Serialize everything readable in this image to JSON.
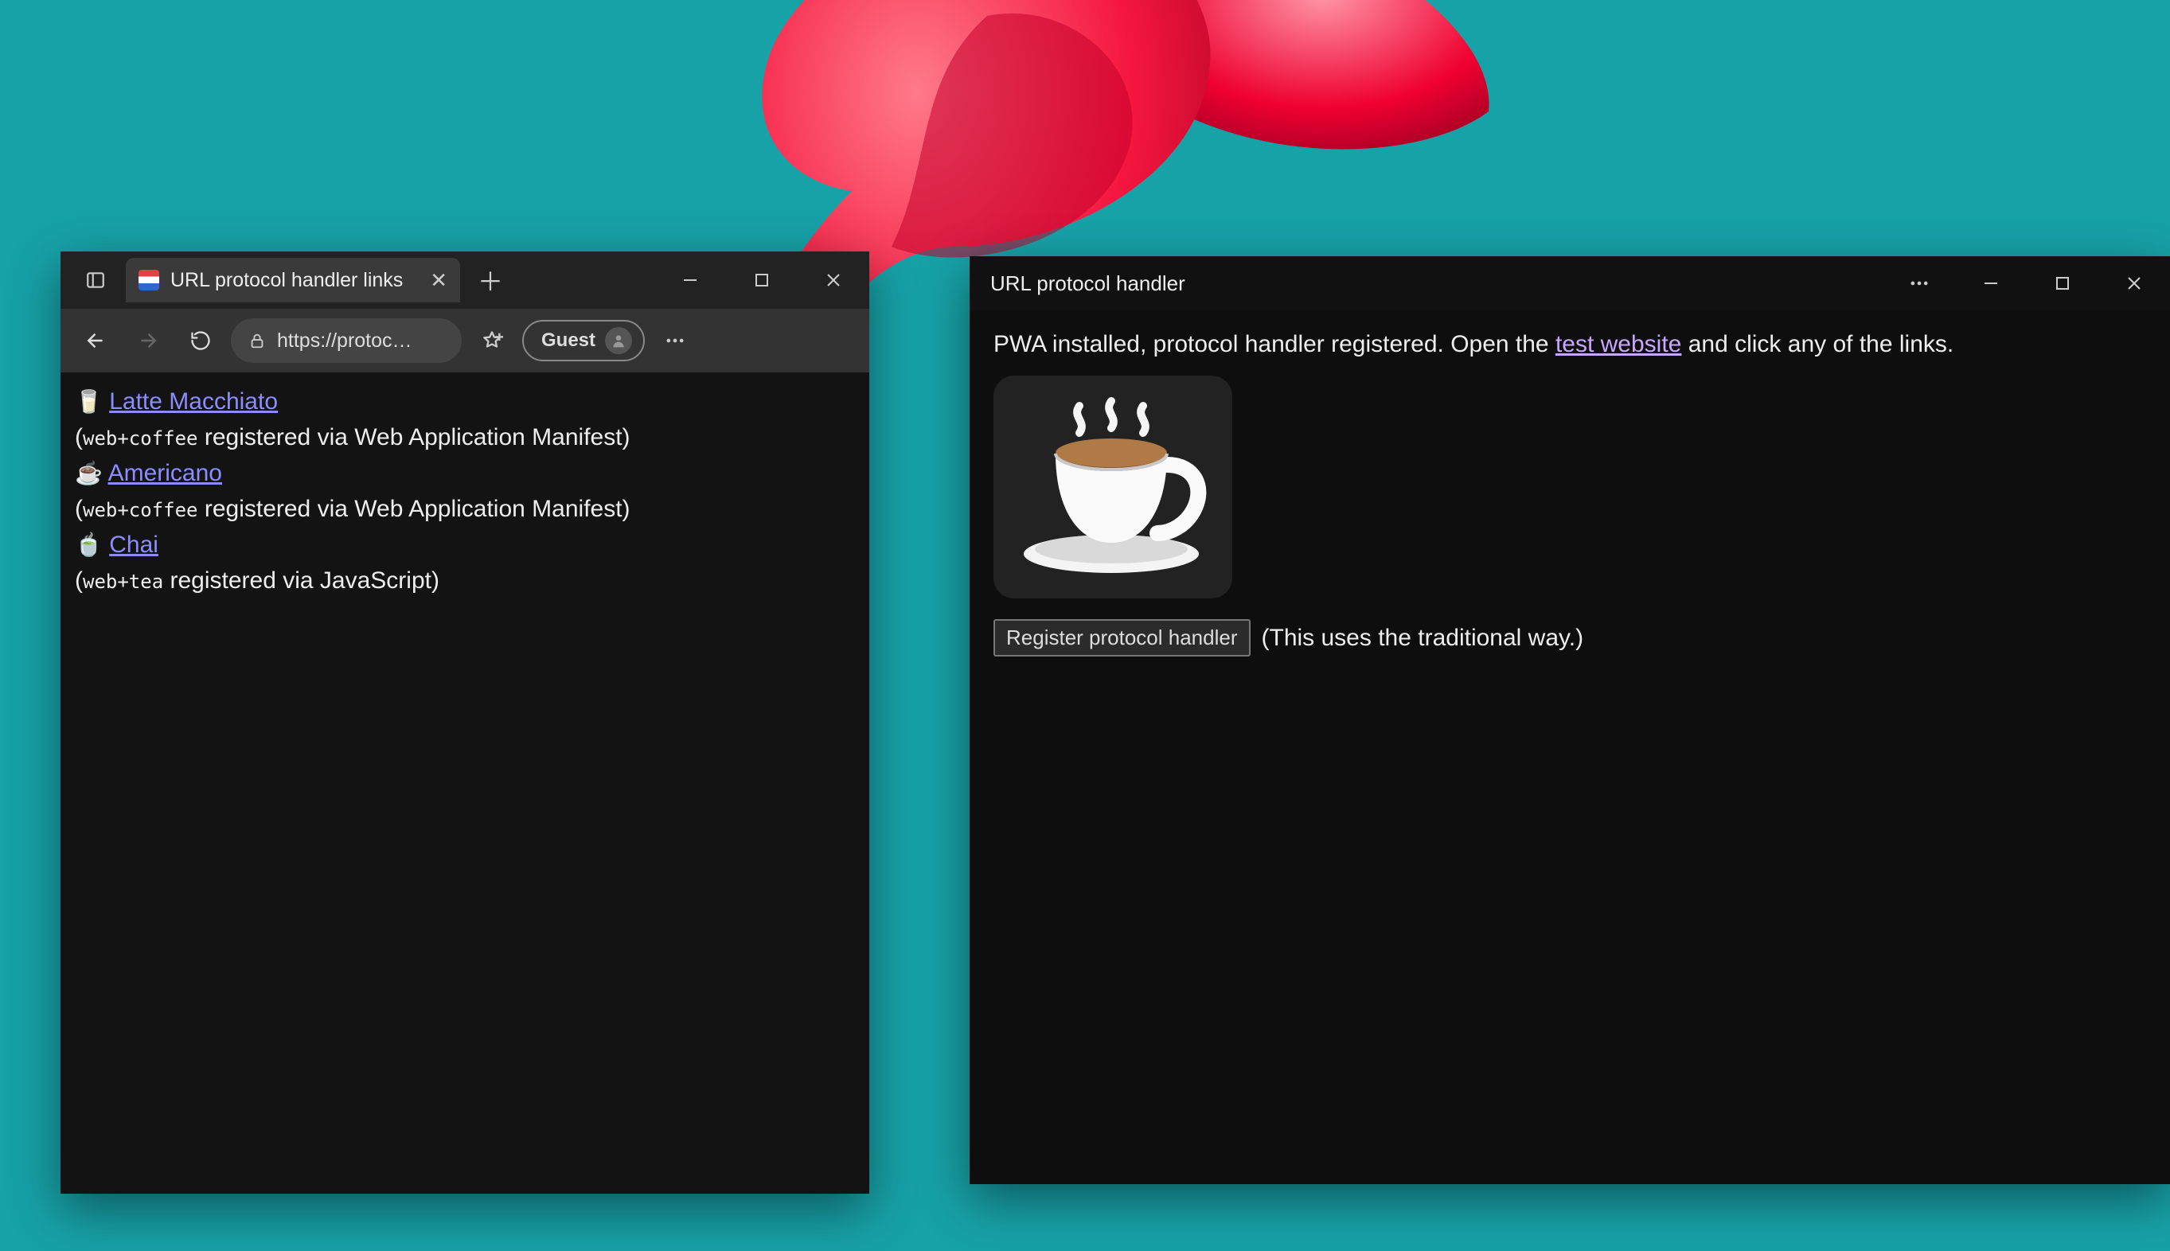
{
  "browser": {
    "tab_title": "URL protocol handler links",
    "address": "https://protoc…",
    "guest_label": "Guest",
    "links": [
      {
        "emoji": "🥛",
        "label": "Latte Macchiato",
        "sub_prefix": "(",
        "code": "web+coffee",
        "sub_suffix": " registered via Web Application Manifest)"
      },
      {
        "emoji": "☕",
        "label": "Americano",
        "sub_prefix": "(",
        "code": "web+coffee",
        "sub_suffix": " registered via Web Application Manifest)"
      },
      {
        "emoji": "🍵",
        "label": "Chai",
        "sub_prefix": "(",
        "code": "web+tea",
        "sub_suffix": " registered via JavaScript)"
      }
    ]
  },
  "pwa": {
    "title": "URL protocol handler",
    "message_pre": "PWA installed, protocol handler registered. Open the ",
    "message_link": "test website",
    "message_post": " and click any of the links.",
    "button_label": "Register protocol handler",
    "button_aside": "(This uses the traditional way.)"
  }
}
